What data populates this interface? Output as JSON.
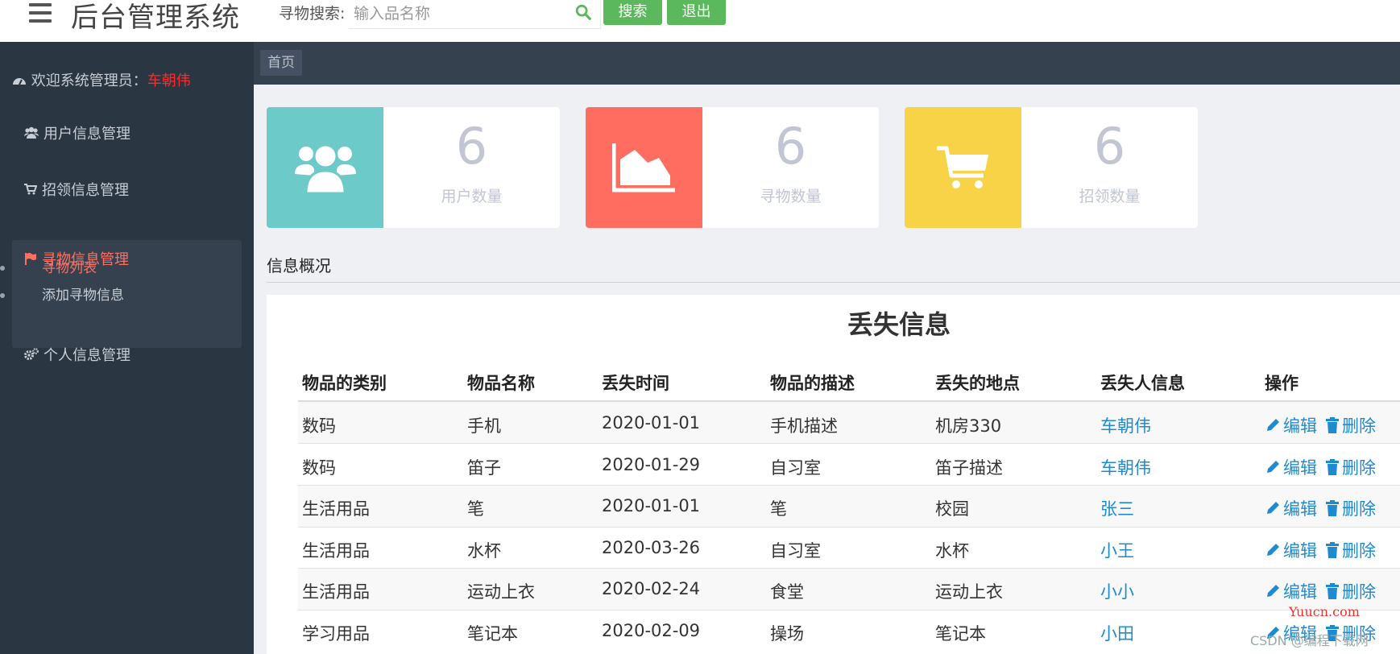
{
  "header": {
    "title": "后台管理系统",
    "search_label": "寻物搜索:",
    "search_placeholder": "输入品名称",
    "search_button": "搜索",
    "logout_button": "退出"
  },
  "sidebar": {
    "welcome_prefix": "欢迎系统管理员：",
    "welcome_user": "车朝伟",
    "items": [
      {
        "label": "用户信息管理"
      },
      {
        "label": "招领信息管理"
      },
      {
        "label": "寻物信息管理",
        "active": true,
        "children": [
          {
            "label": "寻物列表",
            "active": true
          },
          {
            "label": "添加寻物信息"
          }
        ]
      },
      {
        "label": "个人信息管理"
      }
    ]
  },
  "breadcrumb": "首页",
  "stats": [
    {
      "value": "6",
      "label": "用户数量",
      "icon": "users-icon",
      "color": "#6ccac9"
    },
    {
      "value": "6",
      "label": "寻物数量",
      "icon": "area-chart-icon",
      "color": "#ff6c60"
    },
    {
      "value": "6",
      "label": "招领数量",
      "icon": "cart-icon",
      "color": "#f8d347"
    }
  ],
  "overview_title": "信息概况",
  "table": {
    "title": "丢失信息",
    "columns": [
      "物品的类别",
      "物品名称",
      "丢失时间",
      "物品的描述",
      "丢失的地点",
      "丢失人信息",
      "操作"
    ],
    "edit_label": "编辑",
    "delete_label": "删除",
    "rows": [
      [
        "数码",
        "手机",
        "2020-01-01",
        "手机描述",
        "机房330",
        "车朝伟"
      ],
      [
        "数码",
        "笛子",
        "2020-01-29",
        "自习室",
        "笛子描述",
        "车朝伟"
      ],
      [
        "生活用品",
        "笔",
        "2020-01-01",
        "笔",
        "校园",
        "张三"
      ],
      [
        "生活用品",
        "水杯",
        "2020-03-26",
        "自习室",
        "水杯",
        "小王"
      ],
      [
        "生活用品",
        "运动上衣",
        "2020-02-24",
        "食堂",
        "运动上衣",
        "小小"
      ],
      [
        "学习用品",
        "笔记本",
        "2020-02-09",
        "操场",
        "笔记本",
        "小田"
      ]
    ]
  },
  "watermarks": [
    "Yuucn.com",
    "CSDN @编程下载网"
  ],
  "colors": {
    "accent_green": "#5cb85c",
    "link_blue": "#1e8bd0",
    "active_red": "#ff6f61"
  }
}
